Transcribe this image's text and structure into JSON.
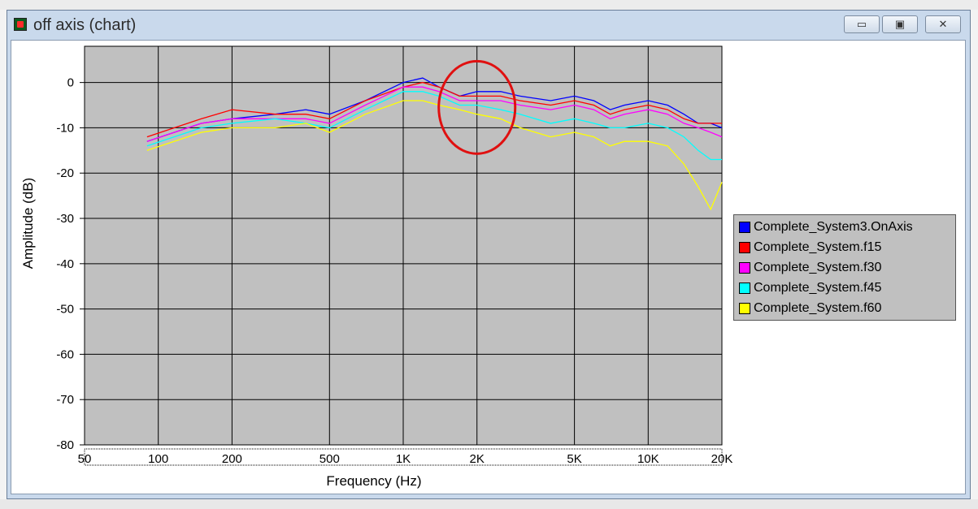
{
  "window": {
    "title": "off axis (chart)",
    "buttons": {
      "minimize": "▭",
      "maximize": "▣",
      "close": "✕"
    }
  },
  "chart_data": {
    "type": "line",
    "title": "",
    "xlabel": "Frequency (Hz)",
    "ylabel": "Amplitude (dB)",
    "xscale": "log",
    "xlim": [
      50,
      20000
    ],
    "ylim": [
      -80,
      8
    ],
    "xticks": [
      50,
      100,
      200,
      500,
      1000,
      2000,
      5000,
      10000,
      20000
    ],
    "xtick_labels": [
      "50",
      "100",
      "200",
      "500",
      "1K",
      "2K",
      "5K",
      "10K",
      "20K"
    ],
    "yticks": [
      0,
      -10,
      -20,
      -30,
      -40,
      -50,
      -60,
      -70,
      -80
    ],
    "ytick_labels": [
      "0",
      "-10",
      "-20",
      "-30",
      "-40",
      "-50",
      "-60",
      "-70",
      "-80"
    ],
    "grid": true,
    "legend": "right",
    "series": [
      {
        "name": "Complete_System3.OnAxis",
        "color": "#0000ff",
        "x": [
          90,
          150,
          200,
          300,
          400,
          500,
          700,
          1000,
          1200,
          1400,
          1700,
          2000,
          2500,
          3000,
          4000,
          5000,
          6000,
          7000,
          8000,
          10000,
          12000,
          14000,
          16000,
          18000,
          20000
        ],
        "y": [
          -13,
          -9,
          -8,
          -7,
          -6,
          -7,
          -4,
          0,
          1,
          -1,
          -3,
          -2,
          -2,
          -3,
          -4,
          -3,
          -4,
          -6,
          -5,
          -4,
          -5,
          -7,
          -9,
          -9,
          -10
        ]
      },
      {
        "name": "Complete_System.f15",
        "color": "#ff0000",
        "x": [
          90,
          150,
          200,
          300,
          400,
          500,
          700,
          1000,
          1200,
          1400,
          1700,
          2000,
          2500,
          3000,
          4000,
          5000,
          6000,
          7000,
          8000,
          10000,
          12000,
          14000,
          16000,
          18000,
          20000
        ],
        "y": [
          -12,
          -8,
          -6,
          -7,
          -7,
          -8,
          -4,
          -1,
          0,
          -1,
          -3,
          -3,
          -3,
          -4,
          -5,
          -4,
          -5,
          -7,
          -6,
          -5,
          -6,
          -8,
          -9,
          -9,
          -9
        ]
      },
      {
        "name": "Complete_System.f30",
        "color": "#ff00ff",
        "x": [
          90,
          150,
          200,
          300,
          400,
          500,
          700,
          1000,
          1200,
          1400,
          1700,
          2000,
          2500,
          3000,
          4000,
          5000,
          6000,
          7000,
          8000,
          10000,
          12000,
          14000,
          16000,
          18000,
          20000
        ],
        "y": [
          -13,
          -9,
          -8,
          -8,
          -8,
          -9,
          -5,
          -1,
          -1,
          -2,
          -4,
          -4,
          -4,
          -5,
          -6,
          -5,
          -6,
          -8,
          -7,
          -6,
          -7,
          -9,
          -10,
          -11,
          -12
        ]
      },
      {
        "name": "Complete_System.f45",
        "color": "#00ffff",
        "x": [
          90,
          150,
          200,
          300,
          400,
          500,
          700,
          1000,
          1200,
          1400,
          1700,
          2000,
          2500,
          3000,
          4000,
          5000,
          6000,
          7000,
          8000,
          10000,
          12000,
          14000,
          16000,
          18000,
          20000
        ],
        "y": [
          -14,
          -10,
          -9,
          -8,
          -9,
          -10,
          -6,
          -2,
          -2,
          -3,
          -5,
          -5,
          -6,
          -7,
          -9,
          -8,
          -9,
          -10,
          -10,
          -9,
          -10,
          -12,
          -15,
          -17,
          -17
        ]
      },
      {
        "name": "Complete_System.f60",
        "color": "#ffff00",
        "x": [
          90,
          150,
          200,
          300,
          400,
          500,
          700,
          1000,
          1200,
          1400,
          1700,
          2000,
          2500,
          3000,
          4000,
          5000,
          6000,
          7000,
          8000,
          10000,
          12000,
          14000,
          16000,
          18000,
          20000
        ],
        "y": [
          -15,
          -11,
          -10,
          -10,
          -9,
          -11,
          -7,
          -4,
          -4,
          -5,
          -6,
          -7,
          -8,
          -10,
          -12,
          -11,
          -12,
          -14,
          -13,
          -13,
          -14,
          -18,
          -23,
          -28,
          -22
        ]
      }
    ],
    "annotations": [
      {
        "type": "circle",
        "color": "#e01010",
        "x": 2000,
        "y": -5.5
      }
    ]
  }
}
